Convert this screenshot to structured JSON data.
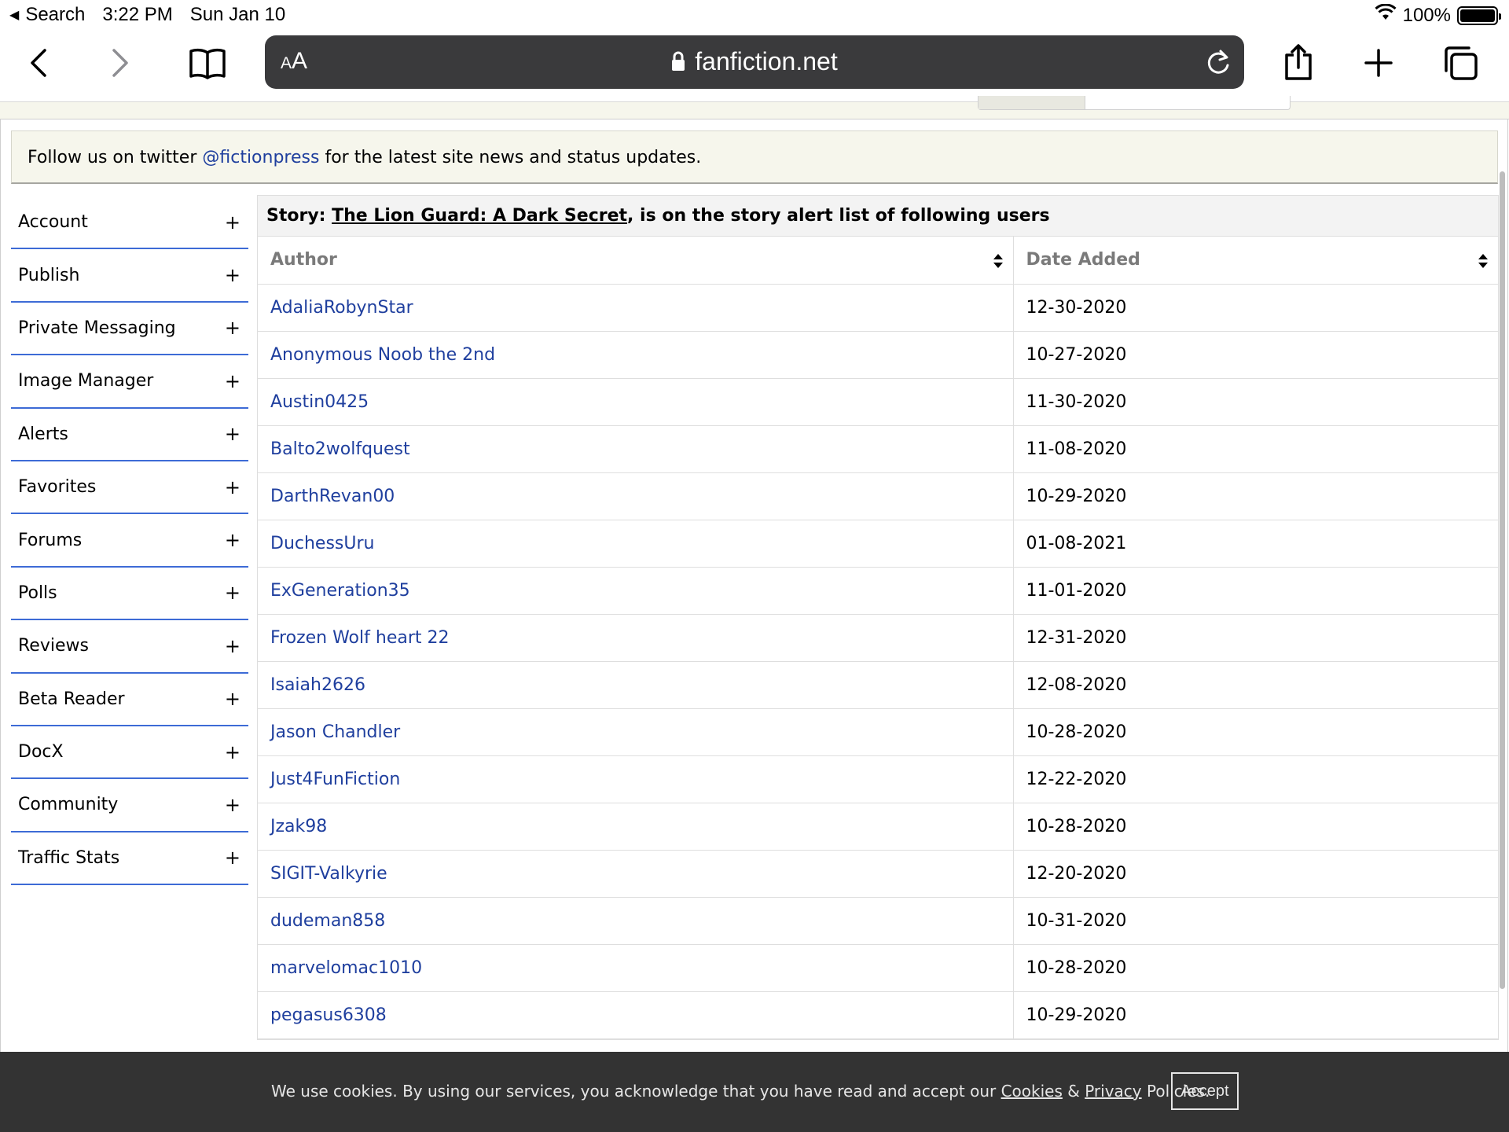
{
  "status_bar": {
    "back_app": "Search",
    "time": "3:22 PM",
    "date": "Sun Jan 10",
    "battery": "100%",
    "battery_level": 1.0
  },
  "browser": {
    "text_size_label_small": "A",
    "text_size_label_big": "A",
    "url": "fanfiction.net"
  },
  "notice": {
    "before": "Follow us on twitter ",
    "link": "@fictionpress",
    "after": " for the latest site news and status updates."
  },
  "sidebar": {
    "items": [
      {
        "label": "Account"
      },
      {
        "label": "Publish"
      },
      {
        "label": "Private Messaging"
      },
      {
        "label": "Image Manager"
      },
      {
        "label": "Alerts"
      },
      {
        "label": "Favorites"
      },
      {
        "label": "Forums"
      },
      {
        "label": "Polls"
      },
      {
        "label": "Reviews"
      },
      {
        "label": "Beta Reader"
      },
      {
        "label": "DocX"
      },
      {
        "label": "Community"
      },
      {
        "label": "Traffic Stats"
      }
    ],
    "expand_glyph": "+"
  },
  "table": {
    "caption_prefix": "Story: ",
    "story_title": "The Lion Guard: A Dark Secret",
    "caption_suffix": ", is on the story alert list of following users",
    "columns": [
      "Author",
      "Date Added"
    ],
    "rows": [
      {
        "author": "AdaliaRobynStar",
        "date": "12-30-2020"
      },
      {
        "author": "Anonymous Noob the 2nd",
        "date": "10-27-2020"
      },
      {
        "author": "Austin0425",
        "date": "11-30-2020"
      },
      {
        "author": "Balto2wolfquest",
        "date": "11-08-2020"
      },
      {
        "author": "DarthRevan00",
        "date": "10-29-2020"
      },
      {
        "author": "DuchessUru",
        "date": "01-08-2021"
      },
      {
        "author": "ExGeneration35",
        "date": "11-01-2020"
      },
      {
        "author": "Frozen Wolf heart 22",
        "date": "12-31-2020"
      },
      {
        "author": "Isaiah2626",
        "date": "12-08-2020"
      },
      {
        "author": "Jason Chandler",
        "date": "10-28-2020"
      },
      {
        "author": "Just4FunFiction",
        "date": "12-22-2020"
      },
      {
        "author": "Jzak98",
        "date": "10-28-2020"
      },
      {
        "author": "SIGIT-Valkyrie",
        "date": "12-20-2020"
      },
      {
        "author": "dudeman858",
        "date": "10-31-2020"
      },
      {
        "author": "marvelomac1010",
        "date": "10-28-2020"
      },
      {
        "author": "pegasus6308",
        "date": "10-29-2020"
      }
    ]
  },
  "cookie_bar": {
    "text_before": "We use cookies. By using our services, you acknowledge that you have read and accept our ",
    "cookies_link": "Cookies",
    "amp": " & ",
    "privacy_link": "Privacy",
    "text_after": " Policies.",
    "accept_label": "Accept"
  },
  "colors": {
    "link": "#1f3f9e",
    "sidebar_rule": "#3d6bd6",
    "notice_bg": "#f6f6ec",
    "address_bar": "#3a3a3c",
    "cookie_bg": "#333333"
  },
  "icons": [
    "back-triangle-icon",
    "wifi-icon",
    "battery-icon",
    "back-chevron-icon",
    "forward-chevron-icon",
    "bookmarks-icon",
    "lock-icon",
    "reload-icon",
    "share-icon",
    "new-tab-icon",
    "tabs-icon",
    "sort-icon",
    "plus-icon"
  ]
}
